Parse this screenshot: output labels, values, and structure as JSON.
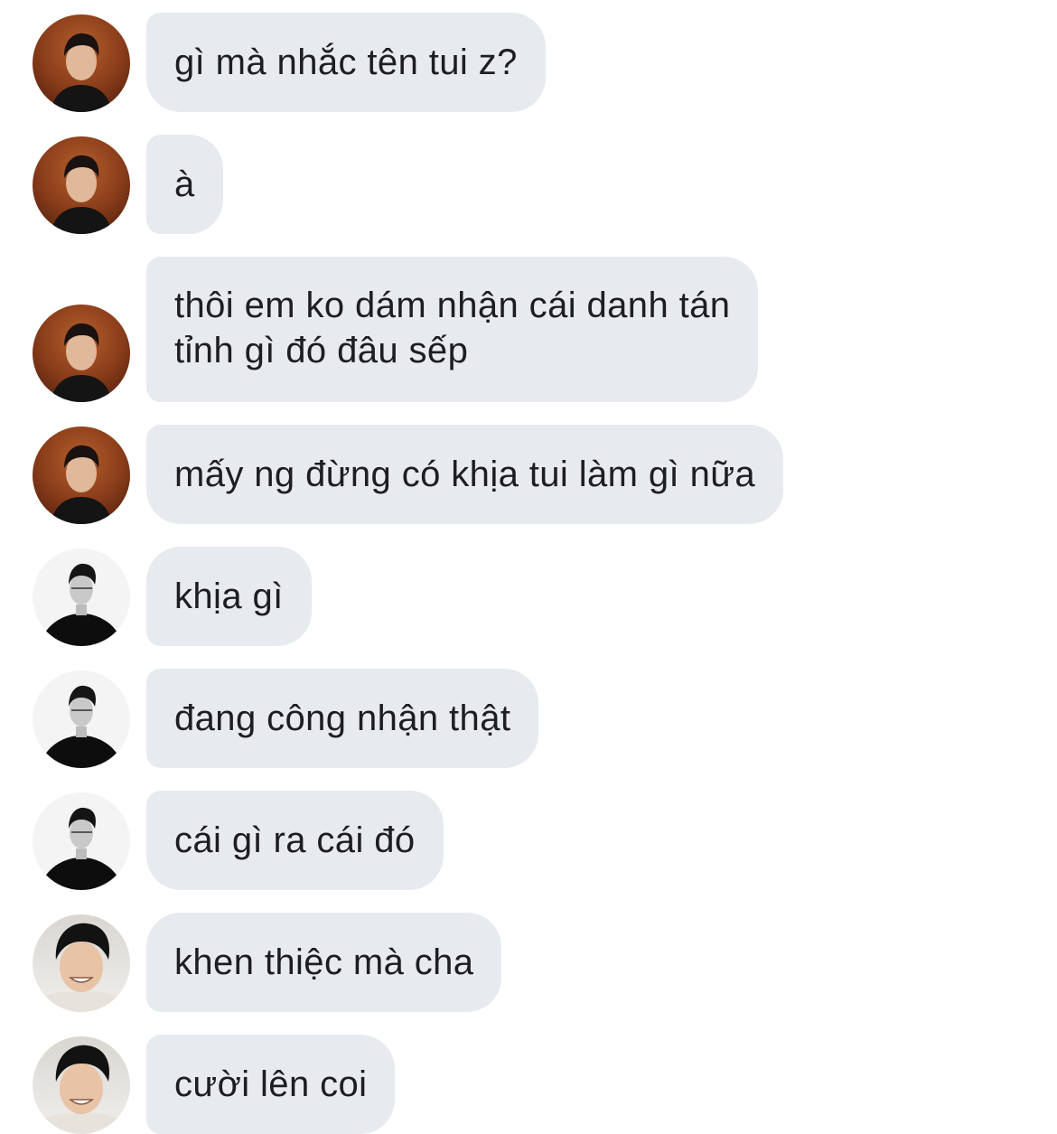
{
  "conversation": {
    "messages": [
      {
        "sender": "user-brown",
        "text": "gì mà nhắc tên tui z?"
      },
      {
        "sender": "user-brown",
        "text": "à"
      },
      {
        "sender": "user-brown",
        "text": "thôi em ko dám nhận cái danh tán\ntỉnh gì đó đâu sếp"
      },
      {
        "sender": "user-brown",
        "text": "mấy ng đừng có khịa tui làm gì nữa"
      },
      {
        "sender": "user-bw",
        "text": "khịa gì"
      },
      {
        "sender": "user-bw",
        "text": "đang công nhận thật"
      },
      {
        "sender": "user-bw",
        "text": "cái gì ra cái đó"
      },
      {
        "sender": "user-smile",
        "text": "khen thiệc mà cha"
      },
      {
        "sender": "user-smile",
        "text": "cười lên coi"
      }
    ]
  },
  "colors": {
    "bubble_bg": "#e7ebef",
    "text": "#1c1e21",
    "page_bg": "#ffffff"
  }
}
